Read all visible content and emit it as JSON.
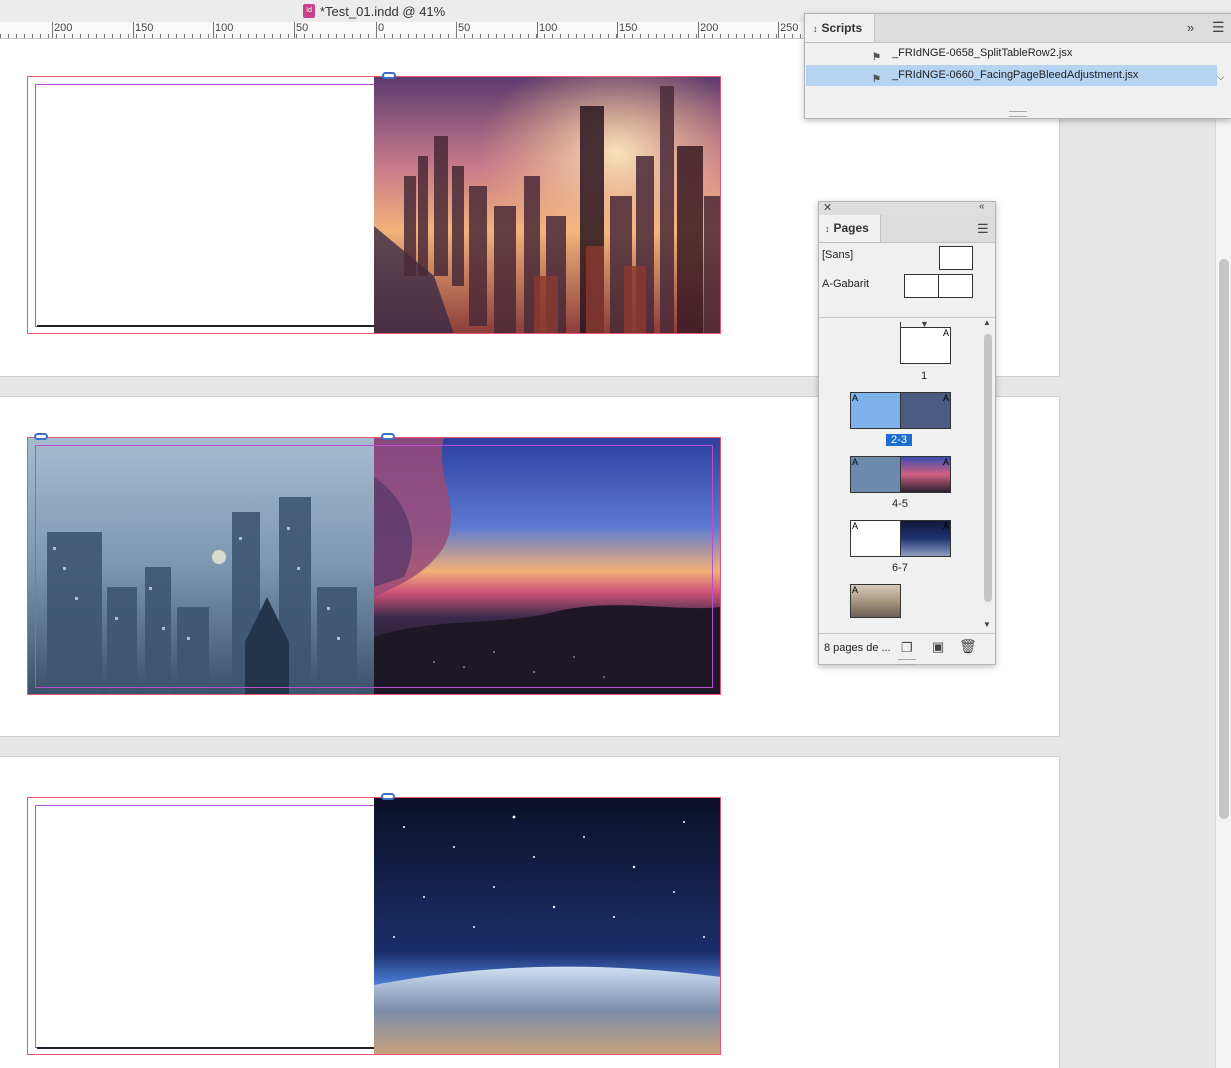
{
  "window": {
    "title": "*Test_01.indd @ 41%",
    "app_icon": "indesign-doc-icon"
  },
  "ruler": {
    "labels": [
      "200",
      "150",
      "100",
      "50",
      "0",
      "50",
      "100",
      "150",
      "200",
      "250"
    ]
  },
  "scripts_panel": {
    "tab_label": "Scripts",
    "items": [
      {
        "label": "_FRIdNGE-0658_SplitTableRow2.jsx",
        "selected": false
      },
      {
        "label": "_FRIdNGE-0660_FacingPageBleedAdjustment.jsx",
        "selected": true
      }
    ]
  },
  "pages_panel": {
    "tab_label": "Pages",
    "masters": [
      {
        "label": "[Sans]"
      },
      {
        "label": "A-Gabarit"
      }
    ],
    "spreads": [
      {
        "label": "1",
        "selected": false
      },
      {
        "label": "2-3",
        "selected": true
      },
      {
        "label": "4-5",
        "selected": false
      },
      {
        "label": "6-7",
        "selected": false
      },
      {
        "label": "",
        "selected": false
      }
    ],
    "master_marker": "A",
    "footer_text": "8 pages de ..."
  },
  "colors": {
    "bleed_guide": "#e8586e",
    "margin_guide": "#b74fd0",
    "selection": "#b6d3f1",
    "page_label_selected": "#1a6fd1"
  }
}
